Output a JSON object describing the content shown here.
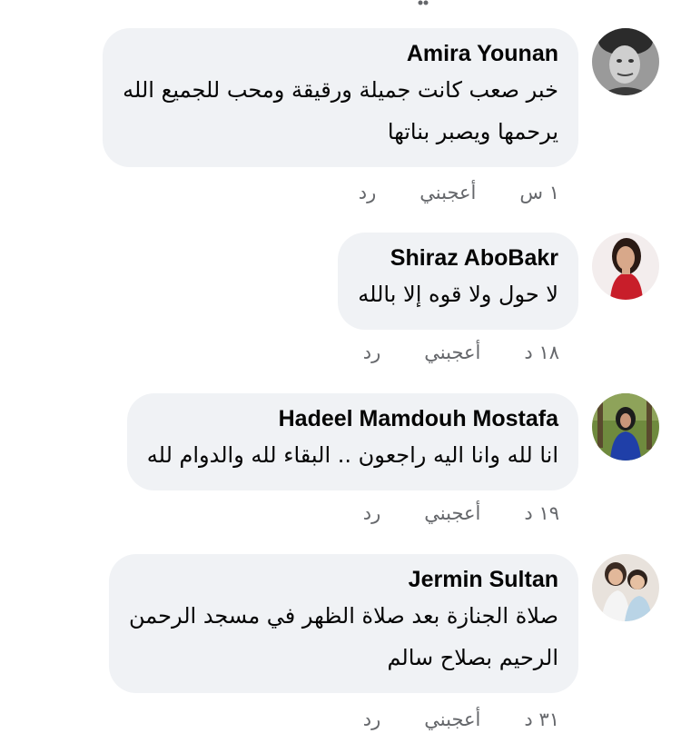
{
  "comments": [
    {
      "author": "Amira Younan",
      "lines": [
        "خبر صعب كانت جميلة ورقيقة ومحب للجميع الله",
        "يرحمها ويصبر بناتها"
      ],
      "time": "١ س",
      "like": "أعجبني",
      "reply": "رد"
    },
    {
      "author": "Shiraz AboBakr",
      "lines": [
        "لا حول ولا قوه إلا بالله"
      ],
      "time": "١٨ د",
      "like": "أعجبني",
      "reply": "رد"
    },
    {
      "author": "Hadeel Mamdouh Mostafa",
      "lines": [
        "انا لله وانا اليه راجعون .. البقاء لله والدوام لله"
      ],
      "time": "١٩ د",
      "like": "أعجبني",
      "reply": "رد"
    },
    {
      "author": "Jermin Sultan",
      "lines": [
        "صلاة الجنازة بعد صلاة الظهر  في مسجد الرحمن",
        "الرحيم بصلاح سالم"
      ],
      "time": "٣١ د",
      "like": "أعجبني",
      "reply": "رد"
    }
  ]
}
